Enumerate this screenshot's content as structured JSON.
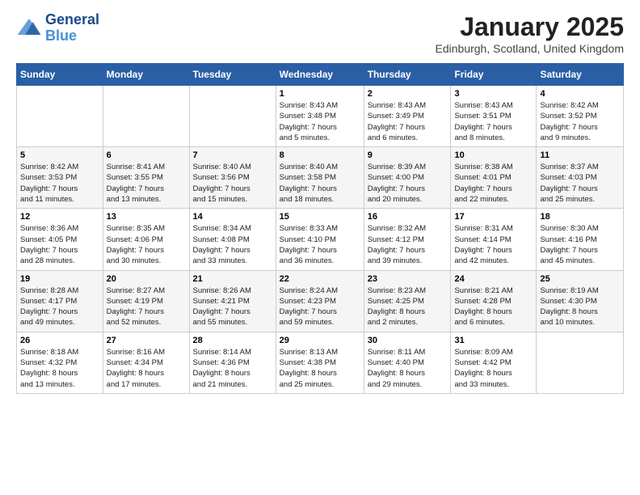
{
  "header": {
    "logo_line1": "General",
    "logo_line2": "Blue",
    "month": "January 2025",
    "location": "Edinburgh, Scotland, United Kingdom"
  },
  "weekdays": [
    "Sunday",
    "Monday",
    "Tuesday",
    "Wednesday",
    "Thursday",
    "Friday",
    "Saturday"
  ],
  "weeks": [
    [
      {
        "day": "",
        "info": ""
      },
      {
        "day": "",
        "info": ""
      },
      {
        "day": "",
        "info": ""
      },
      {
        "day": "1",
        "info": "Sunrise: 8:43 AM\nSunset: 3:48 PM\nDaylight: 7 hours\nand 5 minutes."
      },
      {
        "day": "2",
        "info": "Sunrise: 8:43 AM\nSunset: 3:49 PM\nDaylight: 7 hours\nand 6 minutes."
      },
      {
        "day": "3",
        "info": "Sunrise: 8:43 AM\nSunset: 3:51 PM\nDaylight: 7 hours\nand 8 minutes."
      },
      {
        "day": "4",
        "info": "Sunrise: 8:42 AM\nSunset: 3:52 PM\nDaylight: 7 hours\nand 9 minutes."
      }
    ],
    [
      {
        "day": "5",
        "info": "Sunrise: 8:42 AM\nSunset: 3:53 PM\nDaylight: 7 hours\nand 11 minutes."
      },
      {
        "day": "6",
        "info": "Sunrise: 8:41 AM\nSunset: 3:55 PM\nDaylight: 7 hours\nand 13 minutes."
      },
      {
        "day": "7",
        "info": "Sunrise: 8:40 AM\nSunset: 3:56 PM\nDaylight: 7 hours\nand 15 minutes."
      },
      {
        "day": "8",
        "info": "Sunrise: 8:40 AM\nSunset: 3:58 PM\nDaylight: 7 hours\nand 18 minutes."
      },
      {
        "day": "9",
        "info": "Sunrise: 8:39 AM\nSunset: 4:00 PM\nDaylight: 7 hours\nand 20 minutes."
      },
      {
        "day": "10",
        "info": "Sunrise: 8:38 AM\nSunset: 4:01 PM\nDaylight: 7 hours\nand 22 minutes."
      },
      {
        "day": "11",
        "info": "Sunrise: 8:37 AM\nSunset: 4:03 PM\nDaylight: 7 hours\nand 25 minutes."
      }
    ],
    [
      {
        "day": "12",
        "info": "Sunrise: 8:36 AM\nSunset: 4:05 PM\nDaylight: 7 hours\nand 28 minutes."
      },
      {
        "day": "13",
        "info": "Sunrise: 8:35 AM\nSunset: 4:06 PM\nDaylight: 7 hours\nand 30 minutes."
      },
      {
        "day": "14",
        "info": "Sunrise: 8:34 AM\nSunset: 4:08 PM\nDaylight: 7 hours\nand 33 minutes."
      },
      {
        "day": "15",
        "info": "Sunrise: 8:33 AM\nSunset: 4:10 PM\nDaylight: 7 hours\nand 36 minutes."
      },
      {
        "day": "16",
        "info": "Sunrise: 8:32 AM\nSunset: 4:12 PM\nDaylight: 7 hours\nand 39 minutes."
      },
      {
        "day": "17",
        "info": "Sunrise: 8:31 AM\nSunset: 4:14 PM\nDaylight: 7 hours\nand 42 minutes."
      },
      {
        "day": "18",
        "info": "Sunrise: 8:30 AM\nSunset: 4:16 PM\nDaylight: 7 hours\nand 45 minutes."
      }
    ],
    [
      {
        "day": "19",
        "info": "Sunrise: 8:28 AM\nSunset: 4:17 PM\nDaylight: 7 hours\nand 49 minutes."
      },
      {
        "day": "20",
        "info": "Sunrise: 8:27 AM\nSunset: 4:19 PM\nDaylight: 7 hours\nand 52 minutes."
      },
      {
        "day": "21",
        "info": "Sunrise: 8:26 AM\nSunset: 4:21 PM\nDaylight: 7 hours\nand 55 minutes."
      },
      {
        "day": "22",
        "info": "Sunrise: 8:24 AM\nSunset: 4:23 PM\nDaylight: 7 hours\nand 59 minutes."
      },
      {
        "day": "23",
        "info": "Sunrise: 8:23 AM\nSunset: 4:25 PM\nDaylight: 8 hours\nand 2 minutes."
      },
      {
        "day": "24",
        "info": "Sunrise: 8:21 AM\nSunset: 4:28 PM\nDaylight: 8 hours\nand 6 minutes."
      },
      {
        "day": "25",
        "info": "Sunrise: 8:19 AM\nSunset: 4:30 PM\nDaylight: 8 hours\nand 10 minutes."
      }
    ],
    [
      {
        "day": "26",
        "info": "Sunrise: 8:18 AM\nSunset: 4:32 PM\nDaylight: 8 hours\nand 13 minutes."
      },
      {
        "day": "27",
        "info": "Sunrise: 8:16 AM\nSunset: 4:34 PM\nDaylight: 8 hours\nand 17 minutes."
      },
      {
        "day": "28",
        "info": "Sunrise: 8:14 AM\nSunset: 4:36 PM\nDaylight: 8 hours\nand 21 minutes."
      },
      {
        "day": "29",
        "info": "Sunrise: 8:13 AM\nSunset: 4:38 PM\nDaylight: 8 hours\nand 25 minutes."
      },
      {
        "day": "30",
        "info": "Sunrise: 8:11 AM\nSunset: 4:40 PM\nDaylight: 8 hours\nand 29 minutes."
      },
      {
        "day": "31",
        "info": "Sunrise: 8:09 AM\nSunset: 4:42 PM\nDaylight: 8 hours\nand 33 minutes."
      },
      {
        "day": "",
        "info": ""
      }
    ]
  ]
}
